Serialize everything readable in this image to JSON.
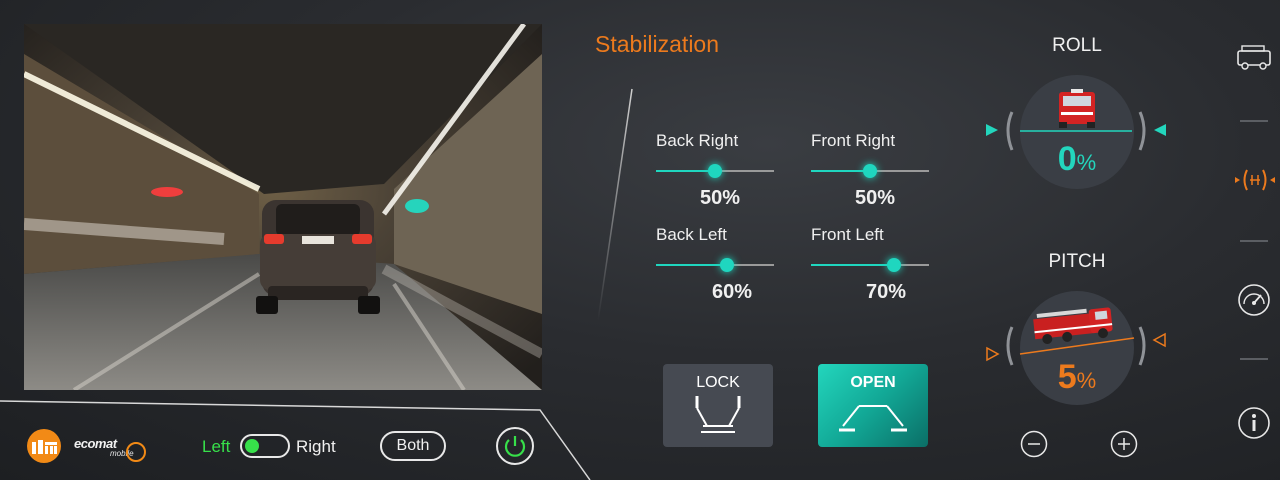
{
  "stabilization": {
    "title": "Stabilization",
    "sliders": [
      {
        "label": "Back Right",
        "value": 50,
        "value_text": "50%"
      },
      {
        "label": "Front Right",
        "value": 50,
        "value_text": "50%"
      },
      {
        "label": "Back Left",
        "value": 60,
        "value_text": "60%"
      },
      {
        "label": "Front Left",
        "value": 70,
        "value_text": "70%"
      }
    ],
    "lock_label": "LOCK",
    "open_label": "OPEN"
  },
  "roll": {
    "title": "ROLL",
    "value": "0",
    "unit": "%"
  },
  "pitch": {
    "title": "PITCH",
    "value": "5",
    "unit": "%"
  },
  "bottom_bar": {
    "toggle_left_label": "Left",
    "toggle_right_label": "Right",
    "both_label": "Both",
    "brand_text": "ecomat",
    "brand_sub": "mobile"
  },
  "right_rail": {
    "icons": [
      "truck-icon",
      "stabilization-icon",
      "speedometer-icon",
      "info-icon"
    ]
  },
  "colors": {
    "accent_teal": "#1fd6bf",
    "accent_orange": "#ec7a1d",
    "toggle_green": "#37e04a"
  }
}
